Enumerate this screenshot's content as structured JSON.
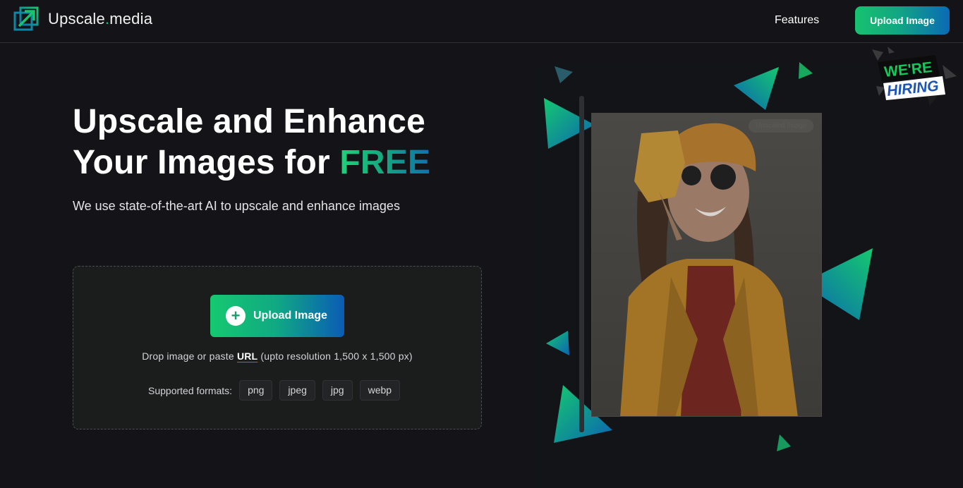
{
  "header": {
    "logo": {
      "text_main": "Upscale",
      "text_dot": ".",
      "text_suffix": "media"
    },
    "nav": {
      "features_label": "Features",
      "upload_label": "Upload Image"
    }
  },
  "hero": {
    "title_line1": "Upscale and Enhance",
    "title_line2_prefix": "Your Images for ",
    "title_highlight": "FREE",
    "subtitle": "We use state-of-the-art AI to upscale and enhance images"
  },
  "dropzone": {
    "upload_button_label": "Upload Image",
    "drop_prefix": "Drop image or paste",
    "url_label": "URL",
    "resolution_note": "(upto resolution 1,500 x 1,500 px)",
    "formats_label": "Supported formats:",
    "formats": [
      "png",
      "jpeg",
      "jpg",
      "webp"
    ]
  },
  "preview": {
    "tag": "Upscaled Image"
  },
  "badge": {
    "line1": "WE'RE",
    "line2": "HIRING"
  },
  "colors": {
    "background": "#141418",
    "accent_green": "#18c16f",
    "accent_blue": "#0b6ab5"
  },
  "icons": [
    "logo-arrow-icon",
    "plus-icon"
  ]
}
